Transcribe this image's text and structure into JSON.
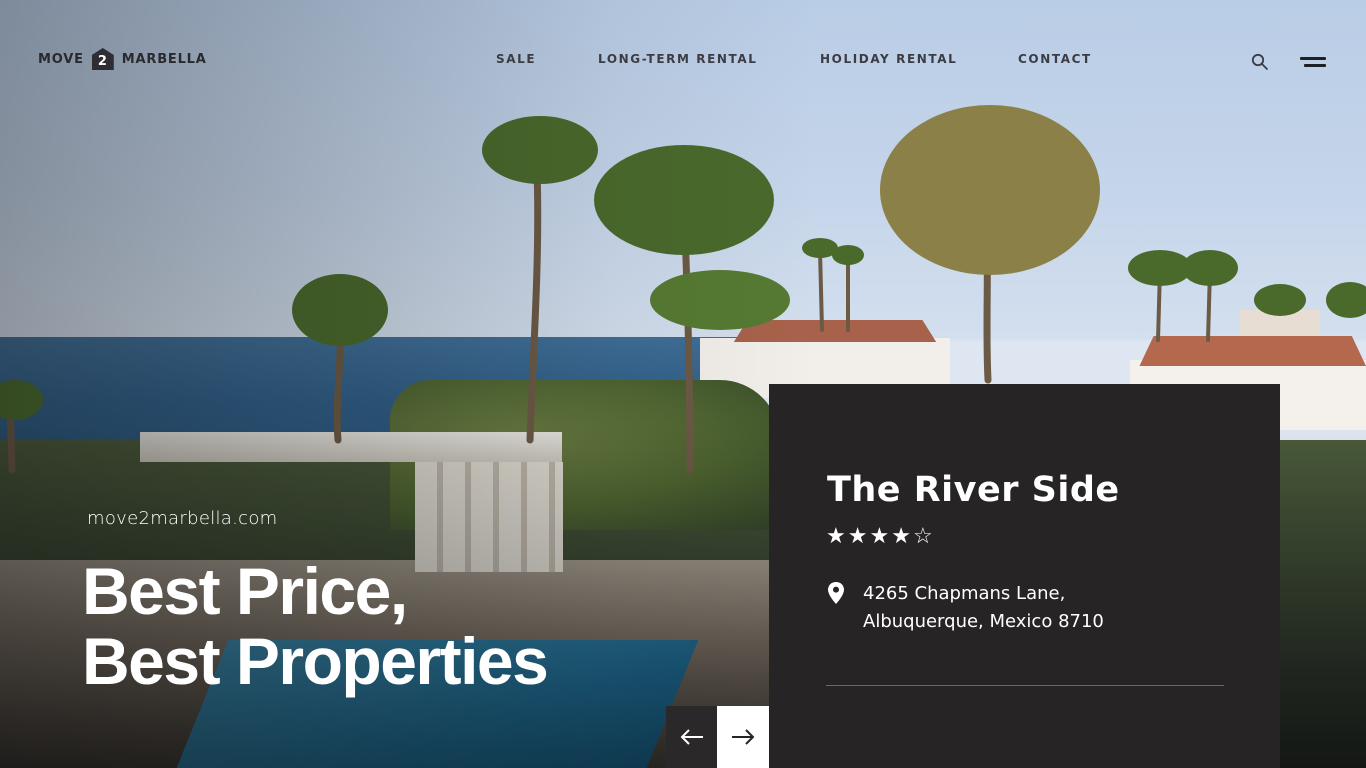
{
  "brand": {
    "word1": "MOVE",
    "badge": "2",
    "word2": "MARBELLA"
  },
  "nav": {
    "items": [
      "SALE",
      "LONG-TERM RENTAL",
      "HOLIDAY RENTAL",
      "CONTACT"
    ]
  },
  "header_icons": {
    "search": "search-icon",
    "menu": "hamburger-menu-icon"
  },
  "hero": {
    "site_url": "move2marbella.com",
    "headline_line1": "Best Price,",
    "headline_line2": "Best Properties"
  },
  "slider": {
    "prev": "arrow-left-icon",
    "next": "arrow-right-icon"
  },
  "property": {
    "name": "The River Side",
    "rating": 4,
    "rating_max": 5,
    "address_line1": "4265  Chapmans Lane,",
    "address_line2": "Albuquerque, Mexico 8710",
    "icon": "location-pin-icon"
  },
  "colors": {
    "card_bg": "#262425",
    "nav_text": "#3b3c44",
    "headline": "#ffffff"
  }
}
